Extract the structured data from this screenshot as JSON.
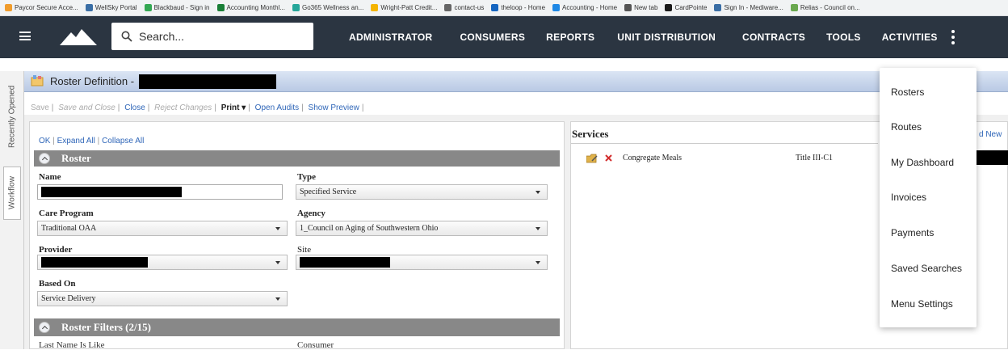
{
  "bookmarks": [
    "Paycor Secure Acce...",
    "WellSky Portal",
    "Blackbaud - Sign in",
    "Accounting Monthl...",
    "Go365 Wellness an...",
    "Wright-Patt Credit...",
    "contact-us",
    "theloop - Home",
    "Accounting - Home",
    "New tab",
    "CardPointe",
    "Sign In - Mediware...",
    "Relias - Council on..."
  ],
  "bookmark_colors": [
    "#f09c2c",
    "#3a6ea5",
    "#34a853",
    "#1a7f37",
    "#26a69a",
    "#f4b400",
    "#666666",
    "#1565c0",
    "#1e88e5",
    "#555555",
    "#1a1a1a",
    "#3a6ea5",
    "#6aa84f"
  ],
  "nav": {
    "search_placeholder": "Search...",
    "menu": [
      "ADMINISTRATOR",
      "CONSUMERS",
      "REPORTS",
      "UNIT DISTRIBUTION",
      "CONTRACTS",
      "TOOLS",
      "ACTIVITIES"
    ]
  },
  "rail": {
    "recent": "Recently Opened",
    "workflow": "Workflow"
  },
  "page": {
    "title": "Roster Definition -"
  },
  "toolbar": {
    "save": "Save",
    "save_close": "Save and Close",
    "close": "Close",
    "reject": "Reject Changes",
    "print": "Print ▾",
    "open_audits": "Open Audits",
    "show_preview": "Show Preview"
  },
  "form": {
    "ok": "OK",
    "expand_all": "Expand All",
    "collapse_all": "Collapse All",
    "section_roster": "Roster",
    "name_label": "Name",
    "type_label": "Type",
    "type_value": "Specified Service",
    "care_program_label": "Care Program",
    "care_program_value": "Traditional OAA",
    "agency_label": "Agency",
    "agency_value": "1_Council on Aging of Southwestern Ohio",
    "provider_label": "Provider",
    "site_label": "Site",
    "based_on_label": "Based On",
    "based_on_value": "Service Delivery",
    "section_filters": "Roster Filters  (2/15)",
    "last_name_label": "Last Name Is Like",
    "consumer_label": "Consumer"
  },
  "services": {
    "title": "Services",
    "add_new": "d New",
    "row": {
      "name": "Congregate Meals",
      "title": "Title III-C1"
    }
  },
  "dropdown": [
    "Rosters",
    "Routes",
    "My Dashboard",
    "Invoices",
    "Payments",
    "Saved Searches",
    "Menu Settings"
  ]
}
